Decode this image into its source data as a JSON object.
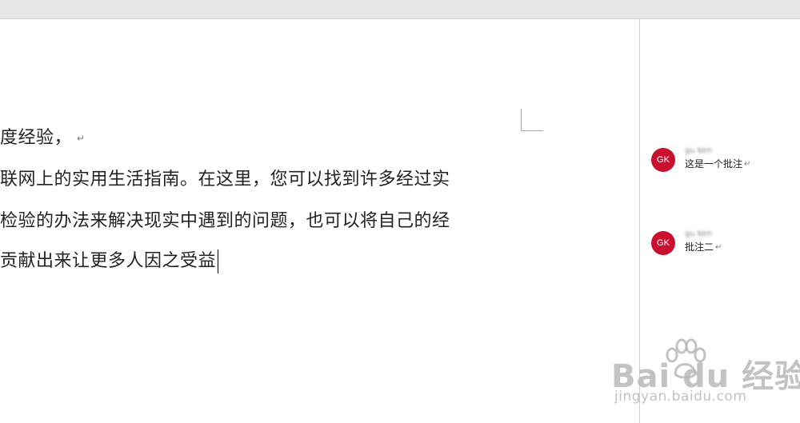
{
  "document": {
    "lines": [
      {
        "text": "度经验，",
        "para_mark": "↵"
      },
      {
        "text": "联网上的实用生活指南。在这里，您可以找到许多经过实",
        "para_mark": ""
      },
      {
        "text": "检验的办法来解决现实中遇到的问题，也可以将自己的经",
        "para_mark": ""
      },
      {
        "text": "贡献出来让更多人因之受益",
        "para_mark": ""
      }
    ]
  },
  "comments": [
    {
      "initials": "GK",
      "author": "gu ken",
      "text": "这是一个批注",
      "para_mark": "↵"
    },
    {
      "initials": "GK",
      "author": "gu ken",
      "text": "批注二",
      "para_mark": "↵"
    }
  ],
  "watermark": {
    "brand": "Bai du 经验",
    "url": "jingyan.baidu.com"
  },
  "colors": {
    "avatar": "#c8102e",
    "toolbar": "#e6e6e6"
  }
}
